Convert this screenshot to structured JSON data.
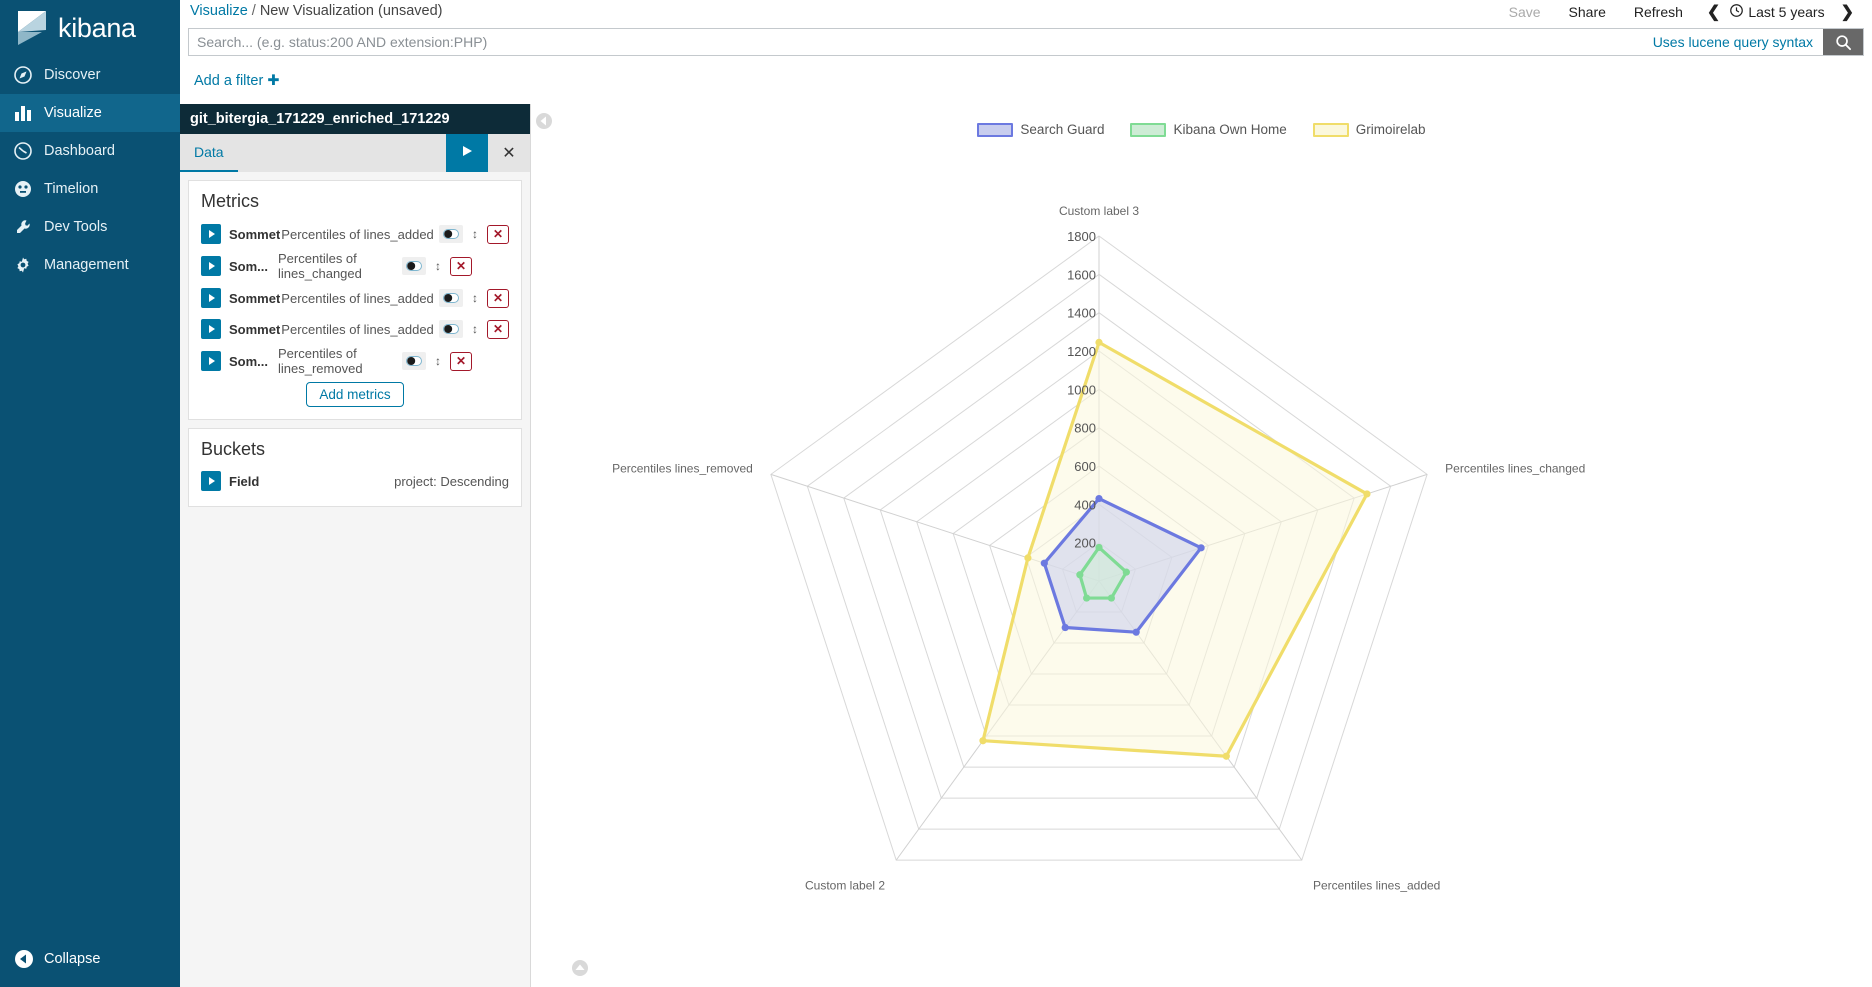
{
  "brand": {
    "name": "kibana",
    "logo_icon": "kibana-logo-icon"
  },
  "sidebar": {
    "items": [
      {
        "label": "Discover",
        "icon": "compass-icon",
        "active": false
      },
      {
        "label": "Visualize",
        "icon": "bar-chart-icon",
        "active": true
      },
      {
        "label": "Dashboard",
        "icon": "dashboard-icon",
        "active": false
      },
      {
        "label": "Timelion",
        "icon": "timelion-icon",
        "active": false
      },
      {
        "label": "Dev Tools",
        "icon": "wrench-icon",
        "active": false
      },
      {
        "label": "Management",
        "icon": "gear-icon",
        "active": false
      }
    ],
    "collapse_label": "Collapse",
    "collapse_icon": "collapse-left-icon"
  },
  "breadcrumb": {
    "root": "Visualize",
    "separator": "/",
    "current": "New Visualization (unsaved)"
  },
  "toolbar": {
    "save_label": "Save",
    "share_label": "Share",
    "refresh_label": "Refresh",
    "prev_icon": "chevron-left-icon",
    "next_icon": "chevron-right-icon",
    "clock_icon": "clock-icon",
    "time_range": "Last 5 years"
  },
  "search": {
    "placeholder": "Search... (e.g. status:200 AND extension:PHP)",
    "value": "",
    "hint": "Uses lucene query syntax",
    "search_icon": "search-icon"
  },
  "filters": {
    "add_label": "Add a filter",
    "add_icon": "plus-icon"
  },
  "editor": {
    "index_title": "git_bitergia_171229_enriched_171229",
    "tab_label": "Data",
    "apply_icon": "play-icon",
    "discard_icon": "close-icon",
    "metrics": {
      "title": "Metrics",
      "rows": [
        {
          "type": "Sommet",
          "desc": "Percentiles of lines_added",
          "wrap": false
        },
        {
          "type": "Som...",
          "desc": "Percentiles of lines_changed",
          "wrap": true
        },
        {
          "type": "Sommet",
          "desc": "Percentiles of lines_added",
          "wrap": false
        },
        {
          "type": "Sommet",
          "desc": "Percentiles of lines_added",
          "wrap": false
        },
        {
          "type": "Som...",
          "desc": "Percentiles of lines_removed",
          "wrap": true
        }
      ],
      "add_label": "Add metrics",
      "toggle_icon": "visibility-toggle-icon",
      "move_icon": "drag-move-icon",
      "delete_icon": "remove-x-icon"
    },
    "buckets": {
      "title": "Buckets",
      "rows": [
        {
          "name": "Field",
          "value": "project: Descending"
        }
      ]
    }
  },
  "vis": {
    "collapse_handle_icon": "chevron-left-circle-icon",
    "bottom_handle_icon": "chevron-up-circle-icon"
  },
  "chart_data": {
    "type": "radar",
    "title": "",
    "axes": [
      "Custom label 3",
      "Percentiles lines_changed",
      "Percentiles lines_added",
      "Custom label 2",
      "Percentiles lines_removed"
    ],
    "rmax": 1800,
    "ticks": [
      200,
      400,
      600,
      800,
      1000,
      1200,
      1400,
      1600,
      1800
    ],
    "grid": true,
    "legend_position": "top",
    "series": [
      {
        "name": "Search Guard",
        "color": "#6c79e0",
        "fill": "#c8cdee",
        "values": [
          430,
          560,
          330,
          300,
          300
        ]
      },
      {
        "name": "Kibana Own Home",
        "color": "#7fdb94",
        "fill": "#cdecd5",
        "values": [
          175,
          150,
          110,
          110,
          105
        ]
      },
      {
        "name": "Grimoirelab",
        "color": "#f0dd6a",
        "fill": "#fbf8dc",
        "values": [
          1245,
          1470,
          1130,
          1030,
          390
        ]
      }
    ]
  }
}
